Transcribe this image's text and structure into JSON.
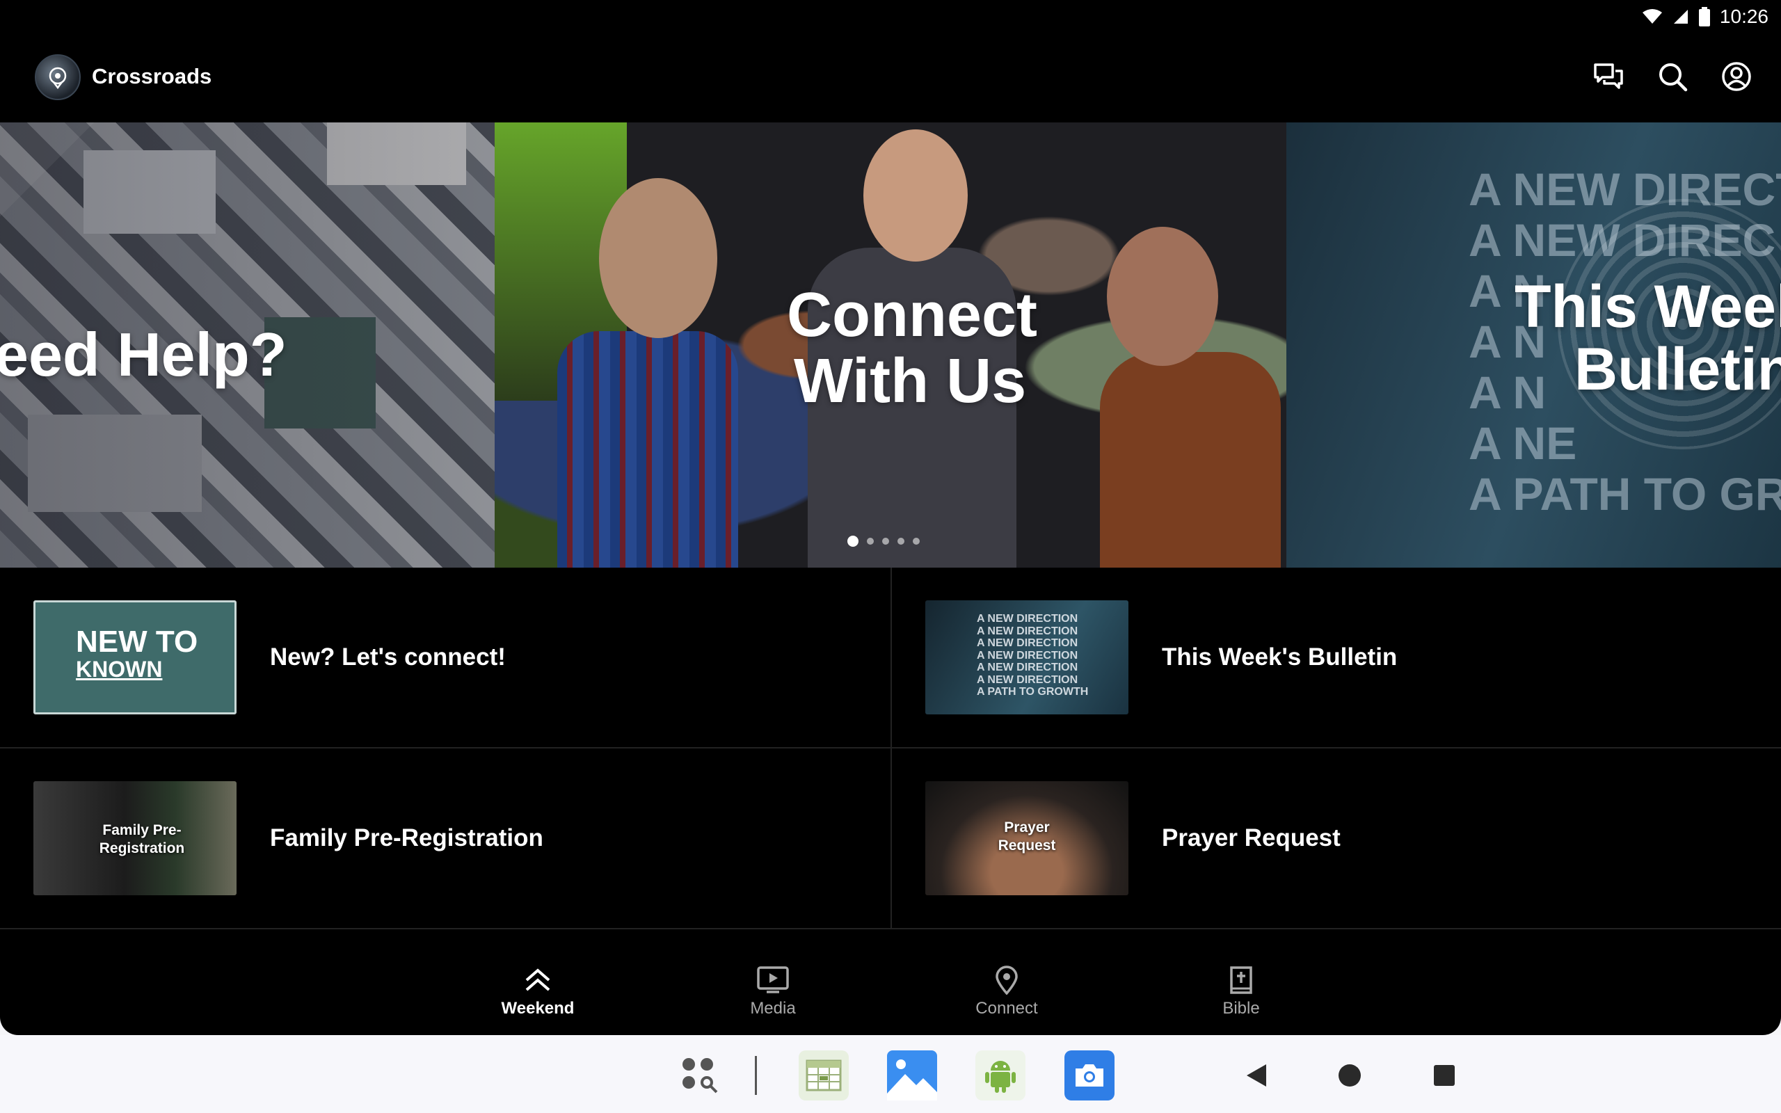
{
  "status_bar": {
    "time": "10:26"
  },
  "app_bar": {
    "title": "Crossroads"
  },
  "hero": {
    "slides": [
      {
        "text": "eed Help?"
      },
      {
        "line1": "Connect",
        "line2": "With Us"
      },
      {
        "line1": "This Weel",
        "line2": "Bulletin",
        "background_text": [
          "A NEW DIRECT",
          "A NEW DIREC",
          "A N",
          "A N",
          "A N",
          "A NE",
          "A PATH TO GRO"
        ]
      }
    ],
    "dots_count": 5,
    "active_dot": 0
  },
  "grid": {
    "items": [
      {
        "label": "New? Let's connect!",
        "thumb_line1": "NEW TO",
        "thumb_line2": "KNOWN"
      },
      {
        "label": "This Week's Bulletin",
        "thumb_lines": [
          "A NEW DIRECTION",
          "A NEW DIRECTION",
          "A NEW DIRECTION",
          "A NEW DIRECTION",
          "A NEW DIRECTION",
          "A NEW DIRECTION",
          "A PATH TO GROWTH"
        ]
      },
      {
        "label": "Family Pre-Registration",
        "thumb_text": "Family Pre-Registration"
      },
      {
        "label": "Prayer Request",
        "thumb_text": "Prayer Request"
      }
    ]
  },
  "bottom_nav": {
    "items": [
      {
        "label": "Weekend",
        "icon": "double-chevron-up-icon",
        "active": true
      },
      {
        "label": "Media",
        "icon": "tv-play-icon",
        "active": false
      },
      {
        "label": "Connect",
        "icon": "location-pin-icon",
        "active": false
      },
      {
        "label": "Bible",
        "icon": "bible-icon",
        "active": false
      }
    ]
  },
  "colors": {
    "background": "#000000",
    "text": "#ffffff",
    "inactive": "#aaaaaa",
    "divider": "#222222"
  }
}
